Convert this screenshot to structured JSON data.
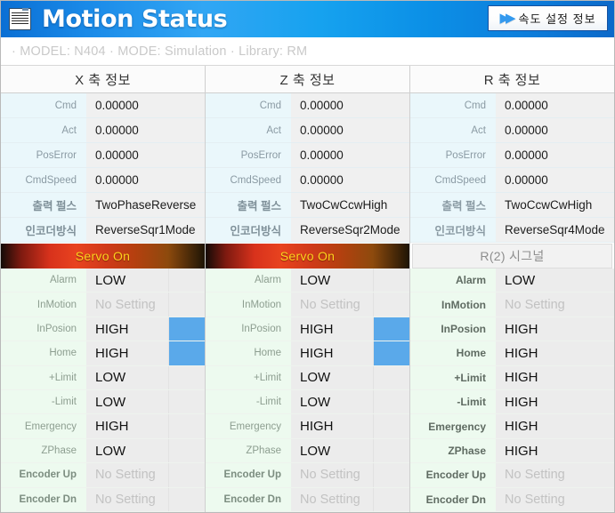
{
  "header": {
    "title": "Motion Status",
    "icon": "spreadsheet-icon",
    "speed_button": {
      "label": "속도 설정 정보",
      "icon": "double-arrow-icon",
      "arrows": "▶▶"
    }
  },
  "statusbar": {
    "model_label": "· MODEL:",
    "model_value": "N404",
    "mode_label": "· MODE:",
    "mode_value": "Simulation",
    "library_label": "· Library:",
    "library_value": "RM",
    "full_text": "· MODEL: N404  · MODE: Simulation  · Library: RM"
  },
  "info_row_labels": [
    "Cmd",
    "Act",
    "PosError",
    "CmdSpeed",
    "출력 펄스",
    "인코더방식"
  ],
  "status_row_labels": [
    "Alarm",
    "InMotion",
    "InPosion",
    "Home",
    "+Limit",
    "-Limit",
    "Emergency",
    "ZPhase",
    "Encoder Up",
    "Encoder Dn"
  ],
  "columns": [
    {
      "header": "X 축 정보",
      "info_values": [
        "0.00000",
        "0.00000",
        "0.00000",
        "0.00000",
        "TwoPhaseReverse",
        "ReverseSqr1Mode"
      ],
      "bar": {
        "type": "servo",
        "label": "Servo On"
      },
      "has_indicator": true,
      "status_values": [
        "LOW",
        "No Setting",
        "HIGH",
        "HIGH",
        "LOW",
        "LOW",
        "HIGH",
        "LOW",
        "No Setting",
        "No Setting"
      ],
      "indicators": [
        false,
        false,
        true,
        true,
        false,
        false,
        false,
        false,
        false,
        false
      ]
    },
    {
      "header": "Z 축 정보",
      "info_values": [
        "0.00000",
        "0.00000",
        "0.00000",
        "0.00000",
        "TwoCwCcwHigh",
        "ReverseSqr2Mode"
      ],
      "bar": {
        "type": "servo",
        "label": "Servo On"
      },
      "has_indicator": true,
      "status_values": [
        "LOW",
        "No Setting",
        "HIGH",
        "HIGH",
        "LOW",
        "LOW",
        "HIGH",
        "LOW",
        "No Setting",
        "No Setting"
      ],
      "indicators": [
        false,
        false,
        true,
        true,
        false,
        false,
        false,
        false,
        false,
        false
      ]
    },
    {
      "header": "R 축 정보",
      "info_values": [
        "0.00000",
        "0.00000",
        "0.00000",
        "0.00000",
        "TwoCcwCwHigh",
        "ReverseSqr4Mode"
      ],
      "bar": {
        "type": "signal",
        "label": "R(2) 시그널"
      },
      "has_indicator": false,
      "status_values": [
        "LOW",
        "No Setting",
        "HIGH",
        "HIGH",
        "HIGH",
        "HIGH",
        "HIGH",
        "HIGH",
        "No Setting",
        "No Setting"
      ],
      "indicators": [
        false,
        false,
        false,
        false,
        false,
        false,
        false,
        false,
        false,
        false
      ]
    }
  ],
  "colors": {
    "header_blue": "#1a8ae8",
    "servo_red": "#d8321c",
    "servo_text": "#ffd21e",
    "indicator_blue": "#5aa9ea",
    "info_label_bg": "#eaf7fb",
    "status_label_bg": "#edfaef"
  }
}
